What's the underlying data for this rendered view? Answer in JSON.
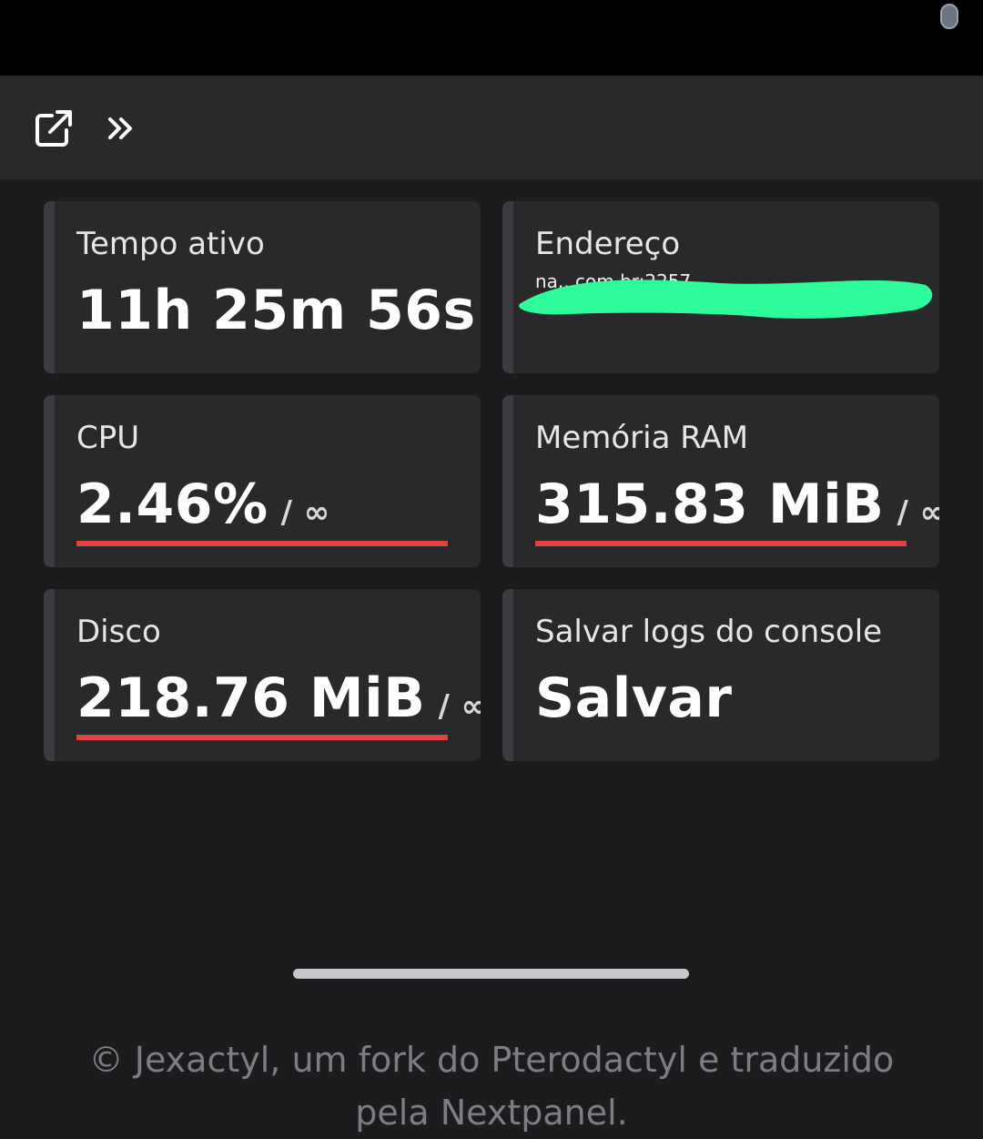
{
  "toolbar": {
    "icons": [
      "external-link-icon",
      "double-chevron-right-icon"
    ]
  },
  "cards": {
    "uptime": {
      "label": "Tempo ativo",
      "value": "11h 25m 56s"
    },
    "address": {
      "label": "Endereço",
      "value": "na...com.br:2257"
    },
    "cpu": {
      "label": "CPU",
      "value": "2.46%",
      "limit": "/ ∞",
      "usage_percent": 100
    },
    "memory": {
      "label": "Memória RAM",
      "value": "315.83 MiB",
      "limit": "/ ∞",
      "usage_percent": 100
    },
    "disk": {
      "label": "Disco",
      "value": "218.76 MiB",
      "limit": "/ ∞",
      "usage_percent": 100
    },
    "logs": {
      "label": "Salvar logs do console",
      "value": "Salvar"
    }
  },
  "footer": {
    "line1": "© Jexactyl, um fork do Pterodactyl e traduzido",
    "line2": "pela Nextpanel."
  },
  "colors": {
    "background": "#1c1c1e",
    "card": "#29292b",
    "usage_bar": "#e0443f",
    "redaction": "#2efc9a"
  }
}
